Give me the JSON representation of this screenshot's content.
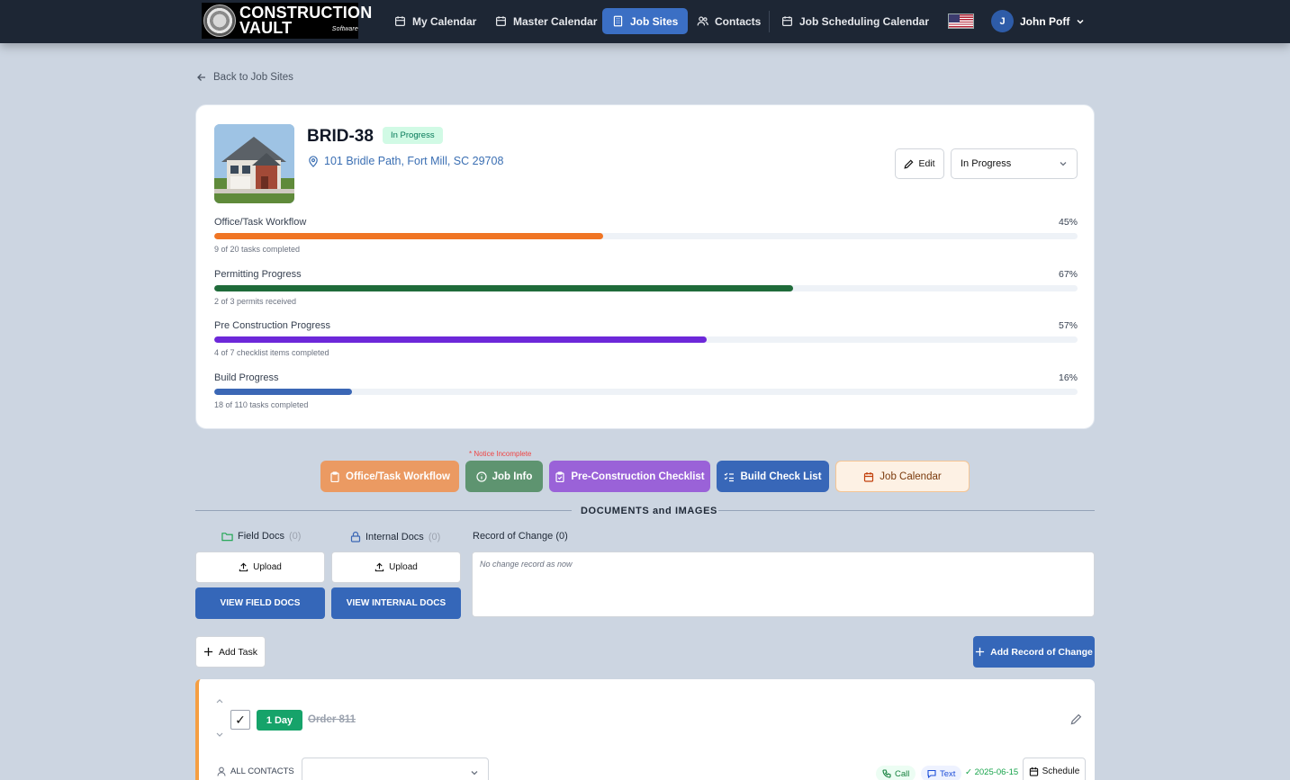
{
  "app": {
    "logo_line1": "CONSTRUCTION",
    "logo_line2": "VAULT",
    "logo_tagline": "Software"
  },
  "nav": {
    "items": [
      {
        "label": "My Calendar",
        "icon": "calendar-icon"
      },
      {
        "label": "Master Calendar",
        "icon": "calendar-icon"
      },
      {
        "label": "Job Sites",
        "icon": "building-icon",
        "active": true
      },
      {
        "label": "Contacts",
        "icon": "users-icon"
      },
      {
        "label": "Job Scheduling Calendar",
        "icon": "calendar-icon"
      }
    ],
    "language_flag": "us-flag-icon",
    "user_initial": "J",
    "user_name": "John Poff"
  },
  "back_link": "Back to Job Sites",
  "job": {
    "title": "BRID-38",
    "status_badge": "In Progress",
    "address": "101 Bridle Path, Fort Mill, SC 29708",
    "edit_label": "Edit",
    "status_value": "In Progress"
  },
  "progress": [
    {
      "label": "Office/Task Workflow",
      "percent_label": "45%",
      "percent": 45,
      "sub": "9 of 20 tasks completed",
      "color": "#f07524"
    },
    {
      "label": "Permitting Progress",
      "percent_label": "67%",
      "percent": 67,
      "sub": "2 of 3 permits received",
      "color": "#1f6b3a"
    },
    {
      "label": "Pre Construction Progress",
      "percent_label": "57%",
      "percent": 57,
      "sub": "4 of 7 checklist items completed",
      "color": "#6d28d9"
    },
    {
      "label": "Build Progress",
      "percent_label": "16%",
      "percent": 16,
      "sub": "18 of 110 tasks completed",
      "color": "#3b67b5"
    }
  ],
  "sections": {
    "notice": "* Notice Incomplete",
    "buttons": [
      {
        "label": "Office/Task Workflow",
        "color": "#eb9a62"
      },
      {
        "label": "Job Info",
        "color": "#5e9470"
      },
      {
        "label": "Pre-Construction Checklist",
        "color": "#9a62d8"
      },
      {
        "label": "Build Check List",
        "color": "#3867b8"
      },
      {
        "label": "Job Calendar",
        "color": "#fdf1e4"
      }
    ]
  },
  "documents": {
    "heading": "DOCUMENTS and IMAGES",
    "field_docs_label": "Field Docs",
    "field_docs_count": "(0)",
    "internal_docs_label": "Internal Docs",
    "internal_docs_count": "(0)",
    "upload_label": "Upload",
    "view_field_label": "VIEW FIELD DOCS",
    "view_internal_label": "VIEW INTERNAL DOCS",
    "record_title": "Record of Change (0)",
    "record_empty": "No change record as now"
  },
  "actions": {
    "add_task": "Add Task",
    "add_record": "Add Record of Change"
  },
  "task": {
    "checked": "✓",
    "duration": "1 Day",
    "name": "Order 811",
    "contacts_label": "ALL CONTACTS",
    "call_label": "Call",
    "text_label": "Text",
    "date": "✓ 2025-06-15",
    "schedule_label": "Schedule"
  }
}
